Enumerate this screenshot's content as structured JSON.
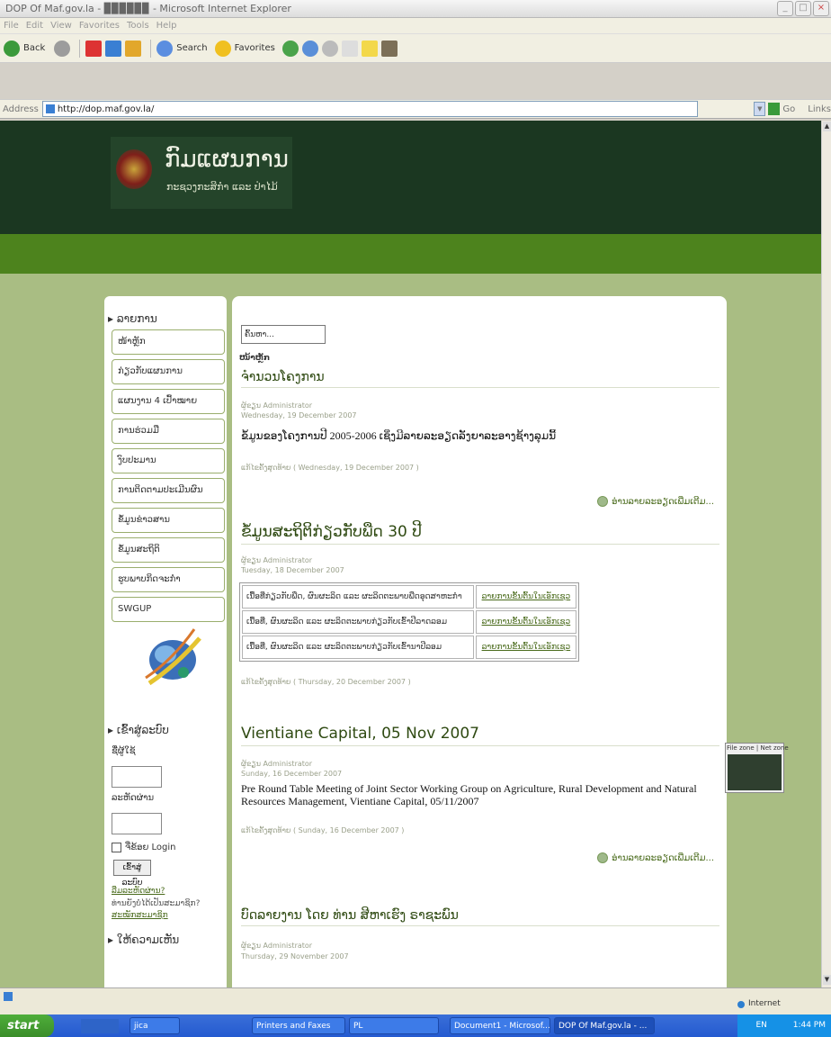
{
  "window": {
    "title": "DOP Of Maf.gov.la - ▉▉▉▉▉▉ - Microsoft Internet Explorer"
  },
  "menu": [
    "File",
    "Edit",
    "View",
    "Favorites",
    "Tools",
    "Help"
  ],
  "toolbar": {
    "back": "Back",
    "search": "Search",
    "favorites": "Favorites"
  },
  "address": {
    "label": "Address",
    "url": "http://dop.maf.gov.la/",
    "go": "Go",
    "links": "Links"
  },
  "site": {
    "title": "ກົມແຜນການ",
    "subtitle": "ກະຊວງກະສິກຳ ແລະ ປ່າໄມ້"
  },
  "sidebar": {
    "section_label": "ລາຍການ",
    "items": [
      {
        "label": "ໜ້າຫຼັກ"
      },
      {
        "label": "ກ່ຽວກັບແຜນການ"
      },
      {
        "label": "ແຜນງານ 4 ເປົ້າໝາຍ"
      },
      {
        "label": "ການຮ່ວມມື"
      },
      {
        "label": "ງົບປະມານ"
      },
      {
        "label": "ການຕິດຕາມປະເມີນຜົນ"
      },
      {
        "label": "ຂໍ້ມູນຂ່າວສານ"
      },
      {
        "label": "ຂໍ້ມູນສະຖິຕິ"
      },
      {
        "label": "ຮູບພາບກິດຈະກຳ"
      },
      {
        "label": "SWGUP"
      }
    ],
    "login": {
      "section_label": "ເຂົ້າສູ່ລະບົບ",
      "username_label": "ຊື່ຜູ້ໃຊ້",
      "password_label": "ລະຫັດຜ່ານ",
      "remember_label": "ຈື່ຂ້ອຍ Login",
      "button_label": "ເຂົ້າສູ່ລະບົບ",
      "forgot_link": "ລືມລະຫັດຜ່ານ?",
      "no_account_text": "ທ່ານຍັງບໍ່ໄດ້ເປັນສະມາຊິກ?",
      "register_link": "ສະໝັກສະມາຊິກ"
    },
    "bottom_section_label": "ໃຫ້ຄວາມເຫັນ"
  },
  "main": {
    "search_placeholder": "ຄົ້ນຫາ...",
    "breadcrumb": "ໜ້າຫຼັກ",
    "read_more": "ອ່ານລາຍລະອຽດເພີ່ມເຕີມ...",
    "articles": [
      {
        "title": "ຈຳນວນໂຄງການ",
        "author": "ຜູ້ຂຽນ Administrator",
        "date": "Wednesday, 19 December 2007",
        "body": "ຂໍ້ມູນຂອງໂຄງການປີ 2005-2006 ເຊິ່ງມີລາຍລະອຽດລັງຍາລະອາງຊ້າງລຸມນີ້",
        "modified": "ແກ້ໄຂຄັ້ງສຸດທ້າຍ ( Wednesday, 19 December 2007 )"
      },
      {
        "title": "ຂໍ້ມູນສະຖິຕິກ່ຽວກັບພືດ 30 ປີ",
        "author": "ຜູ້ຂຽນ Administrator",
        "date": "Tuesday, 18 December 2007",
        "modified": "ແກ້ໄຂຄັ້ງສຸດທ້າຍ ( Thursday, 20 December 2007 )",
        "table": [
          {
            "text": "ເນື້ອທີ່ກ່ຽວກັບພືດ, ຜົນຜະລິດ ແລະ ຜະລິດຕະພາບພືດອຸດສາຫະກຳ",
            "link": "ລາຍການຂັ້ນຕົ້ນໃນເອັກເຊວ"
          },
          {
            "text": "ເນື້ອທີ່, ຜົນຜະລິດ ແລະ ຜະລິດຕະພາບກ່ຽວກັບເຂົ້າປີລາດລອມ",
            "link": "ລາຍການຂັ້ນຕົ້ນໃນເອັກເຊວ"
          },
          {
            "text": "ເນື້ອທີ່, ຜົນຜະລິດ ແລະ ຜະລິດຕະພາບກ່ຽວກັບເຂົ້ານາປີລອມ",
            "link": "ລາຍການຂັ້ນຕົ້ນໃນເອັກເຊວ"
          }
        ]
      },
      {
        "title": "Vientiane Capital, 05 Nov 2007",
        "author": "ຜູ້ຂຽນ Administrator",
        "date": "Sunday, 16 December 2007",
        "body": "Pre Round Table Meeting of Joint Sector Working Group on Agriculture, Rural Development and Natural Resources Management, Vientiane Capital, 05/11/2007",
        "modified": "ແກ້ໄຂຄັ້ງສຸດທ້າຍ ( Sunday, 16 December 2007 )"
      },
      {
        "title": "ບົດລາຍງານ ໂດຍ ທ່ານ ສີຫາເຮົງ ຣາຊະພົນ",
        "author": "ຜູ້ຂຽນ Administrator",
        "date": "Thursday, 29 November 2007"
      }
    ]
  },
  "zone_popup": {
    "file_zone": "File zone",
    "net_zone": "Net zone"
  },
  "statusbar": {
    "zone": "Internet"
  },
  "taskbar": {
    "start": "start",
    "tasks": [
      "jica",
      "Printers and Faxes",
      "PL",
      "Document1 - Microsof...",
      "DOP Of Maf.gov.la - ..."
    ],
    "lang": "EN",
    "clock": "1:44 PM"
  },
  "colors": {
    "header": "#1b3721",
    "greenbar": "#4d831d",
    "background": "#a9bd83",
    "link": "#4a6b1c"
  }
}
